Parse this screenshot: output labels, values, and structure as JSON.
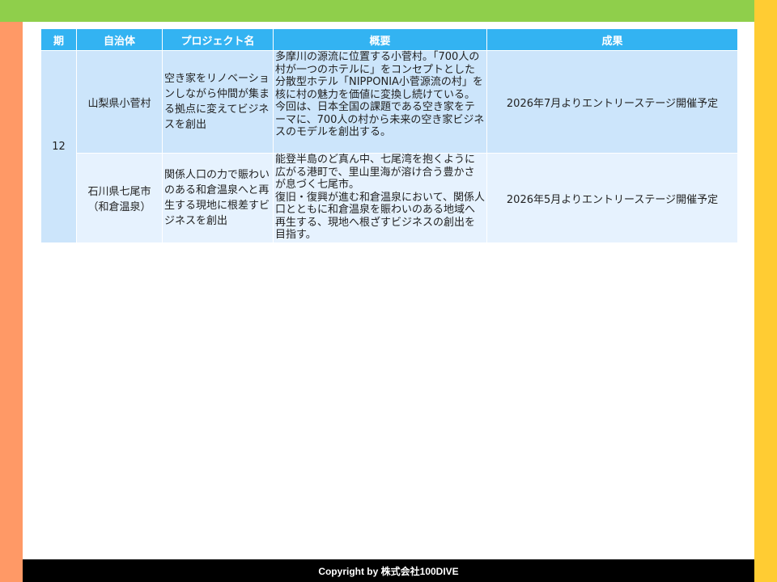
{
  "table": {
    "headers": [
      "期",
      "自治体",
      "プロジェクト名",
      "概要",
      "成果"
    ],
    "period": "12",
    "rows": [
      {
        "municipality": "山梨県小菅村",
        "project": "空き家をリノベーションしながら仲間が集まる拠点に変えてビジネスを創出",
        "summary": "多摩川の源流に位置する小菅村。「700人の村が一つのホテルに」をコンセプトとした分散型ホテル「NIPPONIA小菅源流の村」を核に村の魅力を価値に変換し続けている。\n今回は、日本全国の課題である空き家をテーマに、700人の村から未来の空き家ビジネスのモデルを創出する。",
        "result": "2026年7月よりエントリーステージ開催予定"
      },
      {
        "municipality": "石川県七尾市（和倉温泉）",
        "project": "関係人口の力で賑わいのある和倉温泉へと再生する現地に根差すビジネスを創出",
        "summary": "能登半島のど真ん中、七尾湾を抱くように広がる港町で、里山里海が溶け合う豊かさが息づく七尾市。\n復旧・復興が進む和倉温泉において、関係人口とともに和倉温泉を賑わいのある地域へ再生する、現地へ根ざすビジネスの創出を目指す。",
        "result": "2026年5月よりエントリーステージ開催予定"
      }
    ]
  },
  "footer": {
    "copyright": "Copyright by  株式会社100DIVE"
  }
}
